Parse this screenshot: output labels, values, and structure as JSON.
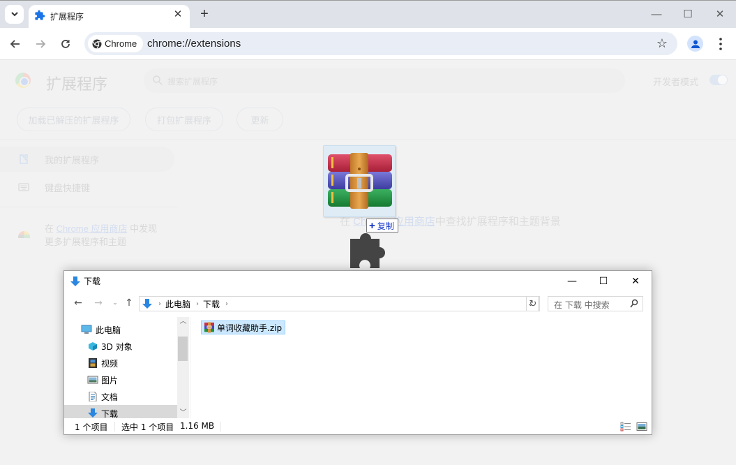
{
  "browser": {
    "tab": {
      "title": "扩展程序",
      "icon": "puzzle-icon"
    },
    "new_tab_label": "+",
    "window_controls": {
      "minimize": "—",
      "maximize": "☐",
      "close": "✕"
    },
    "omnibox": {
      "chip_label": "Chrome",
      "url": "chrome://extensions"
    }
  },
  "extensions_page": {
    "title": "扩展程序",
    "search_placeholder": "搜索扩展程序",
    "developer_mode_label": "开发者模式",
    "developer_mode_on": true,
    "buttons": [
      "加载已解压的扩展程序",
      "打包扩展程序",
      "更新"
    ],
    "sidebar": {
      "items": [
        {
          "label": "我的扩展程序",
          "icon": "puzzle-icon",
          "active": true
        },
        {
          "label": "键盘快捷键",
          "icon": "keyboard-icon",
          "active": false
        }
      ],
      "store_prefix": "在 ",
      "store_link": "Chrome 应用商店",
      "store_suffix": " 中发现",
      "store_line2": "更多扩展程序和主题"
    },
    "empty_message": {
      "prefix": "在 ",
      "link": "Chrome 应用商店",
      "suffix": "中查找扩展程序和主题背景"
    }
  },
  "drag": {
    "dragged_file_icon": "winrar-archive-icon",
    "effect_label": "复制",
    "effect_symbol": "+",
    "cursor": "puzzle-cursor-icon"
  },
  "explorer": {
    "title": "下载",
    "controls": {
      "minimize": "—",
      "maximize": "☐",
      "close": "✕"
    },
    "breadcrumb": [
      "此电脑",
      "下载"
    ],
    "search_placeholder": "在 下载 中搜索",
    "tree": [
      {
        "label": "此电脑",
        "icon": "computer-icon",
        "selected": false
      },
      {
        "label": "3D 对象",
        "icon": "3d-objects-icon",
        "selected": false
      },
      {
        "label": "视频",
        "icon": "videos-icon",
        "selected": false
      },
      {
        "label": "图片",
        "icon": "pictures-icon",
        "selected": false
      },
      {
        "label": "文档",
        "icon": "documents-icon",
        "selected": false
      },
      {
        "label": "下载",
        "icon": "downloads-icon",
        "selected": true
      }
    ],
    "files": [
      {
        "name": "单词收藏助手.zip",
        "icon": "winrar-zip-icon",
        "selected": true
      }
    ],
    "status": {
      "item_count": "1 个项目",
      "selected": "选中 1 个项目",
      "size": "1.16 MB"
    }
  }
}
